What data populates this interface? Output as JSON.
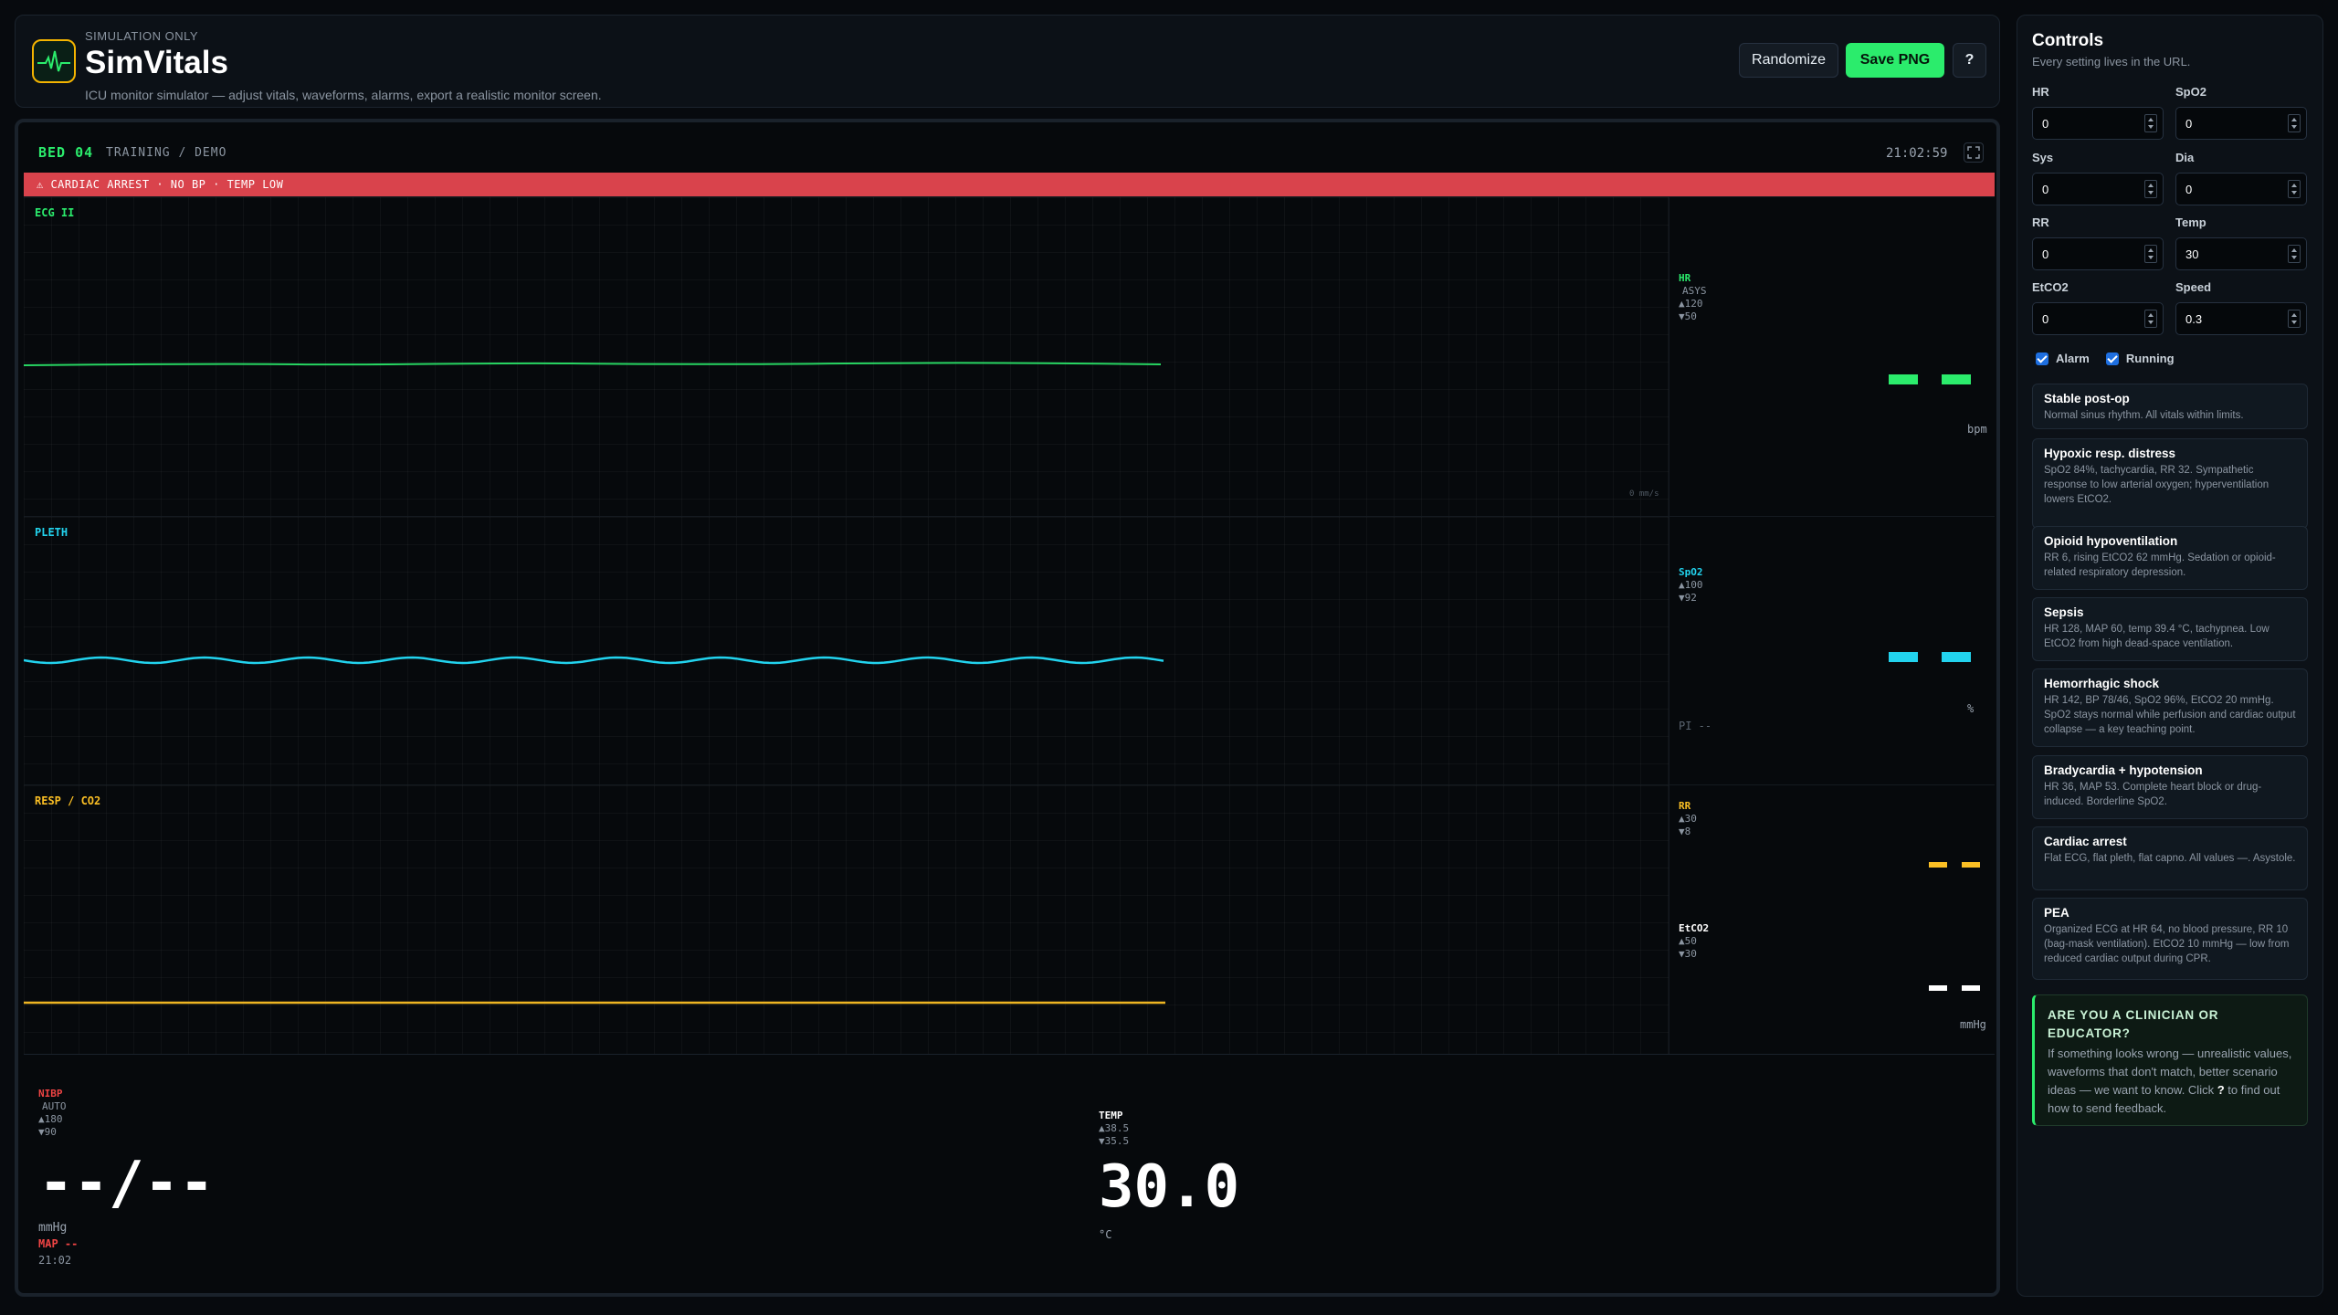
{
  "app": {
    "eyebrow": "SIMULATION ONLY",
    "title": "SimVitals",
    "subtitle": "ICU monitor simulator — adjust vitals, waveforms, alarms, export a realistic monitor screen.",
    "buttons": {
      "randomize": "Randomize",
      "save": "Save PNG",
      "help": "?"
    }
  },
  "monitor": {
    "bed": "BED 04",
    "mode": "TRAINING / DEMO",
    "clock": "21:02:59",
    "alarm": "⚠ CARDIAC ARREST · NO BP · TEMP LOW",
    "ecg": {
      "label": "ECG II",
      "sweep": "0 mm/s",
      "param": "HR",
      "rhythm": "ASYS",
      "hi": "▲120",
      "lo": "▼50",
      "unit": "bpm"
    },
    "pleth": {
      "label": "PLETH",
      "param": "SpO2",
      "hi": "▲100",
      "lo": "▼92",
      "unit": "%",
      "pi": "PI --"
    },
    "resp": {
      "label": "RESP / CO2",
      "rr": {
        "param": "RR",
        "hi": "▲30",
        "lo": "▼8"
      },
      "etco2": {
        "param": "EtCO2",
        "hi": "▲50",
        "lo": "▼30"
      },
      "unit": "mmHg"
    },
    "nibp": {
      "label": "NIBP",
      "mode": "AUTO",
      "hi": "▲180",
      "lo": "▼90",
      "value": "--/--",
      "unit": "mmHg",
      "map": "MAP --",
      "time": "21:02"
    },
    "temp": {
      "label": "TEMP",
      "hi": "▲38.5",
      "lo": "▼35.5",
      "value": "30.0",
      "unit": "°C"
    },
    "colors": {
      "ecg": "#2bec6c",
      "pleth": "#22d3ee",
      "resp": "#fbbf24",
      "etco2": "#ffffff",
      "nibp": "#ef4444"
    }
  },
  "controls": {
    "title": "Controls",
    "subtitle": "Every setting lives in the URL.",
    "fields": {
      "hr": {
        "label": "HR",
        "value": "0"
      },
      "spo2": {
        "label": "SpO2",
        "value": "0"
      },
      "sys": {
        "label": "Sys",
        "value": "0"
      },
      "dia": {
        "label": "Dia",
        "value": "0"
      },
      "rr": {
        "label": "RR",
        "value": "0"
      },
      "temp": {
        "label": "Temp",
        "value": "30"
      },
      "etco2": {
        "label": "EtCO2",
        "value": "0"
      },
      "speed": {
        "label": "Speed",
        "value": "0.3"
      }
    },
    "alarm_label": "Alarm",
    "alarm_checked": true,
    "running_label": "Running",
    "running_checked": true,
    "scenarios": [
      {
        "name": "Stable post-op",
        "desc": "Normal sinus rhythm. All vitals within limits."
      },
      {
        "name": "Hypoxic resp. distress",
        "desc": "SpO2 84%, tachycardia, RR 32. Sympathetic response to low arterial oxygen; hyperventilation lowers EtCO2."
      },
      {
        "name": "Opioid hypoventilation",
        "desc": "RR 6, rising EtCO2 62 mmHg. Sedation or opioid-related respiratory depression."
      },
      {
        "name": "Sepsis",
        "desc": "HR 128, MAP 60, temp 39.4 °C, tachypnea. Low EtCO2 from high dead-space ventilation."
      },
      {
        "name": "Hemorrhagic shock",
        "desc": "HR 142, BP 78/46, SpO2 96%, EtCO2 20 mmHg. SpO2 stays normal while perfusion and cardiac output collapse — a key teaching point."
      },
      {
        "name": "Bradycardia + hypotension",
        "desc": "HR 36, MAP 53. Complete heart block or drug-induced. Borderline SpO2."
      },
      {
        "name": "Cardiac arrest",
        "desc": "Flat ECG, flat pleth, flat capno. All values —. Asystole."
      },
      {
        "name": "PEA",
        "desc": "Organized ECG at HR 64, no blood pressure, RR 10 (bag-mask ventilation). EtCO2 10 mmHg — low from reduced cardiac output during CPR."
      }
    ],
    "feedback": {
      "title": "ARE YOU A CLINICIAN OR EDUCATOR?",
      "text_before": "If something looks wrong — unrealistic values, waveforms that don't match, better scenario ideas — we want to know. Click",
      "text_key": "?",
      "text_after": "to find out how to send feedback."
    }
  }
}
